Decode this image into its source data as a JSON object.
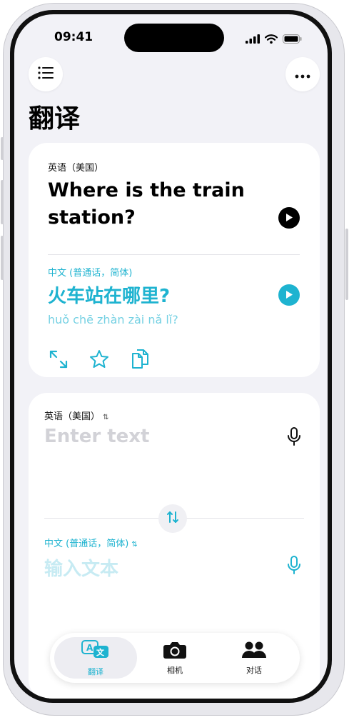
{
  "status": {
    "time": "09:41"
  },
  "page_title": "翻译",
  "result_card": {
    "source_lang": "英语（美国）",
    "source_text": "Where is the train station?",
    "target_lang": "中文 (普通话，简体)",
    "target_text": "火车站在哪里?",
    "pinyin": "huǒ chē zhàn zài nǎ lǐ?"
  },
  "input_card": {
    "source_lang": "英语（美国）",
    "source_placeholder": "Enter text",
    "target_lang": "中文 (普通话，简体)",
    "target_placeholder": "输入文本"
  },
  "tabs": [
    {
      "label": "翻译",
      "icon": "translate-icon",
      "active": true
    },
    {
      "label": "相机",
      "icon": "camera-icon",
      "active": false
    },
    {
      "label": "对话",
      "icon": "people-icon",
      "active": false
    }
  ],
  "colors": {
    "accent": "#1eb3d0",
    "accent_light": "#76d1e3",
    "background": "#f2f2f7"
  }
}
